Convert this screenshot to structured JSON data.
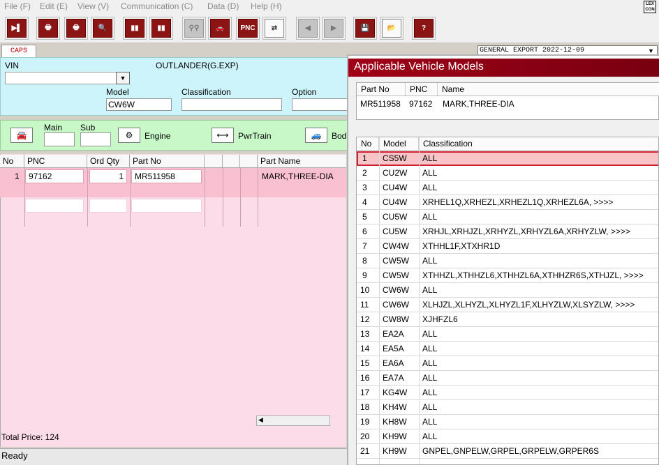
{
  "menu": [
    "File (F)",
    "Edit (E)",
    "View (V)",
    "Communication (C)",
    "Data (D)",
    "Help (H)"
  ],
  "logo_text": "LEX\nCON",
  "toolbar": {
    "buttons": [
      {
        "name": "exit-icon",
        "glyph": "▶▌"
      },
      {
        "name": "print-preview-icon",
        "glyph": "🖶"
      },
      {
        "name": "print-icon",
        "glyph": "🖶"
      },
      {
        "name": "search-print-icon",
        "glyph": "🔍"
      },
      {
        "name": "book-icon",
        "glyph": "▮▮"
      },
      {
        "name": "book-list-icon",
        "glyph": "▮▮"
      },
      {
        "name": "binoculars-icon",
        "glyph": "⚲⚲"
      },
      {
        "name": "car-icon",
        "glyph": "🚗"
      },
      {
        "name": "pnc-icon",
        "glyph": "PNC"
      },
      {
        "name": "transfer-icon",
        "glyph": "⇄"
      },
      {
        "name": "prev-icon",
        "glyph": "◀"
      },
      {
        "name": "next-icon",
        "glyph": "▶"
      },
      {
        "name": "save-icon",
        "glyph": "💾"
      },
      {
        "name": "open-folder-icon",
        "glyph": "📂"
      },
      {
        "name": "help-icon",
        "glyph": "?"
      }
    ]
  },
  "tab": "CAPS",
  "export_combo": "GENERAL EXPORT    2022-12-09",
  "header": {
    "vin_label": "VIN",
    "vin_value": "",
    "vehicle": "OUTLANDER(G.EXP)",
    "model_label": "Model",
    "model_value": "CW6W",
    "classification_label": "Classification",
    "classification_value": "",
    "option_label": "Option",
    "option_value": ""
  },
  "groups": {
    "main_label": "Main",
    "sub_label": "Sub",
    "engine_label": "Engine",
    "pwrtrain_label": "PwrTrain",
    "body_label": "Bod"
  },
  "parts": {
    "columns": [
      "No",
      "PNC",
      "Ord Qty",
      "Part No",
      "",
      "",
      "",
      "Part Name"
    ],
    "rows": [
      {
        "no": "1",
        "pnc": "97162",
        "qty": "1",
        "part_no": "MR511958",
        "name": "MARK,THREE-DIA"
      }
    ]
  },
  "total_price": "Total Price: 124",
  "status": "Ready",
  "dialog": {
    "title": "Applicable Vehicle Models",
    "part_columns": [
      "Part No",
      "PNC",
      "Name"
    ],
    "part_row": {
      "part_no": "MR511958",
      "pnc": "97162",
      "name": "MARK,THREE-DIA"
    },
    "model_columns": [
      "No",
      "Model",
      "Classification"
    ],
    "models": [
      {
        "no": "1",
        "model": "CS5W",
        "cls": "ALL"
      },
      {
        "no": "2",
        "model": "CU2W",
        "cls": "ALL"
      },
      {
        "no": "3",
        "model": "CU4W",
        "cls": "ALL"
      },
      {
        "no": "4",
        "model": "CU4W",
        "cls": "XRHEL1Q,XRHEZL,XRHEZL1Q,XRHEZL6A,  >>>>"
      },
      {
        "no": "5",
        "model": "CU5W",
        "cls": "ALL"
      },
      {
        "no": "6",
        "model": "CU5W",
        "cls": "XRHJL,XRHJZL,XRHYZL,XRHYZL6A,XRHYZLW,  >>>>"
      },
      {
        "no": "7",
        "model": "CW4W",
        "cls": "XTHHL1F,XTXHR1D"
      },
      {
        "no": "8",
        "model": "CW5W",
        "cls": "ALL"
      },
      {
        "no": "9",
        "model": "CW5W",
        "cls": "XTHHZL,XTHHZL6,XTHHZL6A,XTHHZR6S,XTHJZL,  >>>>"
      },
      {
        "no": "10",
        "model": "CW6W",
        "cls": "ALL"
      },
      {
        "no": "11",
        "model": "CW6W",
        "cls": "XLHJZL,XLHYZL,XLHYZL1F,XLHYZLW,XLSYZLW,  >>>>"
      },
      {
        "no": "12",
        "model": "CW8W",
        "cls": "XJHFZL6"
      },
      {
        "no": "13",
        "model": "EA2A",
        "cls": "ALL"
      },
      {
        "no": "14",
        "model": "EA5A",
        "cls": "ALL"
      },
      {
        "no": "15",
        "model": "EA6A",
        "cls": "ALL"
      },
      {
        "no": "16",
        "model": "EA7A",
        "cls": "ALL"
      },
      {
        "no": "17",
        "model": "KG4W",
        "cls": "ALL"
      },
      {
        "no": "18",
        "model": "KH4W",
        "cls": "ALL"
      },
      {
        "no": "19",
        "model": "KH8W",
        "cls": "ALL"
      },
      {
        "no": "20",
        "model": "KH9W",
        "cls": "ALL"
      },
      {
        "no": "21",
        "model": "KH9W",
        "cls": "GNPEL,GNPELW,GRPEL,GRPELW,GRPER6S"
      }
    ],
    "selected_row": 0
  }
}
